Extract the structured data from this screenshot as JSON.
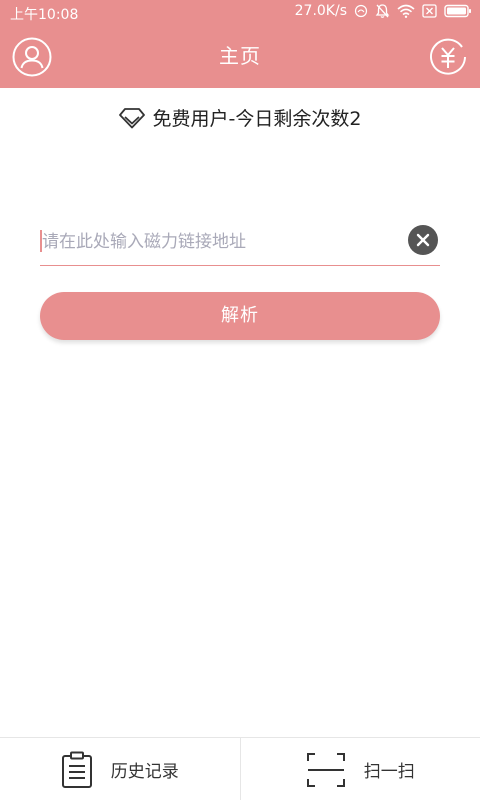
{
  "status_bar": {
    "time": "上午10:08",
    "network_speed": "27.0K/s",
    "icons": [
      "dnd-icon",
      "mute-bell-icon",
      "wifi-icon",
      "sim-off-icon",
      "battery-icon"
    ]
  },
  "header": {
    "title": "主页",
    "left_icon": "user-profile-icon",
    "right_icon": "yuan-coin-icon"
  },
  "user_status": {
    "icon": "diamond-icon",
    "text": "免费用户-今日剩余次数2"
  },
  "magnet_input": {
    "value": "",
    "placeholder": "请在此处输入磁力链接地址",
    "clear_icon": "clear-x-icon"
  },
  "parse_button": {
    "label": "解析"
  },
  "bottom_nav": {
    "items": [
      {
        "label": "历史记录",
        "icon": "clipboard-history-icon"
      },
      {
        "label": "扫一扫",
        "icon": "scan-frame-icon"
      }
    ]
  },
  "colors": {
    "accent": "#e88f8f",
    "text_primary": "#222222",
    "placeholder": "#a9a9b8",
    "clear_button": "#555555",
    "divider": "#e6e6e6"
  }
}
